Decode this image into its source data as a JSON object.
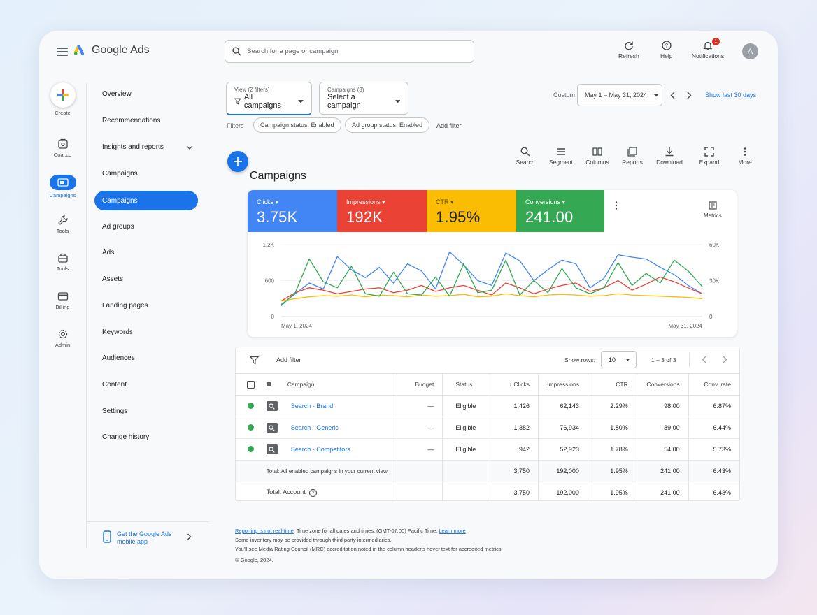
{
  "app": {
    "title": "Google Ads"
  },
  "search": {
    "placeholder": "Search for a page or campaign"
  },
  "header": {
    "refresh": "Refresh",
    "help": "Help",
    "notifications": "Notifications",
    "notification_count": "1",
    "avatar_initial": "A"
  },
  "rail": {
    "create": "Create",
    "goals": "Coal:co",
    "campaigns": "Campaigns",
    "tools1": "Tools",
    "tools2": "Tools",
    "billing": "Billing",
    "admin": "Admin"
  },
  "nav": {
    "overview": "Overview",
    "recommendations": "Recommendations",
    "insights": "Insights and reports",
    "campaigns_group": "Campaigns",
    "campaigns": "Campaigns",
    "ad_groups": "Ad groups",
    "ads": "Ads",
    "assets": "Assets",
    "landing_pages": "Landing pages",
    "keywords": "Keywords",
    "audiences": "Audiences",
    "content": "Content",
    "settings": "Settings",
    "change_history": "Change history",
    "app_promo": "Get the Google Ads mobile app"
  },
  "view_filter": {
    "label": "View (2 filters)",
    "value": "All campaigns"
  },
  "campaign_filter": {
    "label": "Campaigns (3)",
    "value": "Select a campaign"
  },
  "date": {
    "custom_label": "Custom",
    "range": "May 1 – May 31, 2024",
    "show_last": "Show last 30 days"
  },
  "filters": {
    "label": "Filters",
    "chip1": "Campaign status: Enabled",
    "chip2": "Ad group status: Enabled",
    "add": "Add filter"
  },
  "toolbar": {
    "search": "Search",
    "segment": "Segment",
    "columns": "Columns",
    "reports": "Reports",
    "download": "Download",
    "expand": "Expand",
    "more": "More"
  },
  "page_title": "Campaigns",
  "metrics": [
    {
      "label": "Clicks",
      "value": "3.75K",
      "color": "#4285f4"
    },
    {
      "label": "Impressions",
      "value": "192K",
      "color": "#ea4335"
    },
    {
      "label": "CTR",
      "value": "1.95%",
      "color": "#fbbc04"
    },
    {
      "label": "Conversions",
      "value": "241.00",
      "color": "#34a853"
    }
  ],
  "metrics_button": "Metrics",
  "chart_data": {
    "type": "line",
    "x_start_label": "May 1, 2024",
    "x_end_label": "May 31, 2024",
    "y_left_ticks": [
      "0",
      "600",
      "1.2K"
    ],
    "y_right_ticks": [
      "0",
      "30K",
      "60K"
    ],
    "ylim_left": [
      0,
      1200
    ],
    "ylim_right": [
      0,
      60000
    ],
    "series": [
      {
        "color": "#4285f4",
        "axis": "left",
        "values": [
          200,
          380,
          560,
          460,
          1000,
          780,
          650,
          820,
          560,
          880,
          760,
          460,
          1080,
          860,
          600,
          520,
          1060,
          930,
          600,
          780,
          940,
          880,
          480,
          640,
          1030,
          990,
          960,
          820,
          700,
          520,
          380
        ]
      },
      {
        "color": "#ea4335",
        "axis": "right",
        "values": [
          13000,
          20000,
          24000,
          22000,
          19000,
          21000,
          23000,
          24000,
          20000,
          22000,
          26000,
          21000,
          24000,
          26000,
          22000,
          18000,
          28000,
          24000,
          19000,
          23000,
          26000,
          28000,
          21000,
          24000,
          30000,
          22000,
          27000,
          33000,
          29000,
          24000,
          19000
        ]
      },
      {
        "color": "#fbbc04",
        "axis": "left",
        "values": [
          260,
          300,
          330,
          350,
          340,
          360,
          330,
          360,
          350,
          330,
          360,
          340,
          350,
          370,
          330,
          340,
          380,
          350,
          330,
          360,
          370,
          360,
          340,
          350,
          380,
          360,
          350,
          340,
          330,
          320,
          300
        ]
      },
      {
        "color": "#34a853",
        "axis": "right",
        "values": [
          9000,
          20000,
          48000,
          29000,
          24000,
          42000,
          19000,
          17000,
          37000,
          19000,
          18000,
          33000,
          17000,
          44000,
          20000,
          22000,
          47000,
          18000,
          30000,
          20000,
          40000,
          24000,
          19000,
          24000,
          45000,
          26000,
          36000,
          28000,
          47000,
          38000,
          25000
        ]
      }
    ]
  },
  "table": {
    "add_filter": "Add filter",
    "show_rows_label": "Show rows:",
    "show_rows_value": "10",
    "pagination": "1 – 3 of 3",
    "headers": {
      "campaign": "Campaign",
      "budget": "Budget",
      "status": "Status",
      "clicks": "Clicks",
      "impressions": "Impressions",
      "ctr": "CTR",
      "conversions": "Conversions",
      "conv_rate": "Conv. rate"
    },
    "rows": [
      {
        "name": "Search - Brand",
        "budget": "—",
        "status": "Eligible",
        "clicks": "1,426",
        "impressions": "62,143",
        "ctr": "2.29%",
        "conversions": "98.00",
        "conv_rate": "6.87%"
      },
      {
        "name": "Search - Generic",
        "budget": "—",
        "status": "Eligible",
        "clicks": "1,382",
        "impressions": "76,934",
        "ctr": "1.80%",
        "conversions": "89.00",
        "conv_rate": "6.44%"
      },
      {
        "name": "Search - Competitors",
        "budget": "—",
        "status": "Eligible",
        "clicks": "942",
        "impressions": "52,923",
        "ctr": "1.78%",
        "conversions": "54.00",
        "conv_rate": "5.73%"
      }
    ],
    "totals": [
      {
        "label": "Total: All enabled campaigns in your current view",
        "clicks": "3,750",
        "impressions": "192,000",
        "ctr": "1.95%",
        "conversions": "241.00",
        "conv_rate": "6.43%"
      },
      {
        "label": "Total: Account",
        "clicks": "3,750",
        "impressions": "192,000",
        "ctr": "1.95%",
        "conversions": "241.00",
        "conv_rate": "6.43%"
      }
    ]
  },
  "footer": {
    "not_realtime": "Reporting is not real-time",
    "timezone": ". Time zone for all dates and times: (GMT-07:00) Pacific Time. ",
    "learn_more": "Learn more",
    "line2": "Some inventory may be provided through third party intermediaries.",
    "line3": "You'll see Media Rating Council (MRC) accreditation noted in the column header's hover text for accredited metrics.",
    "copyright": "© Google, 2024."
  }
}
